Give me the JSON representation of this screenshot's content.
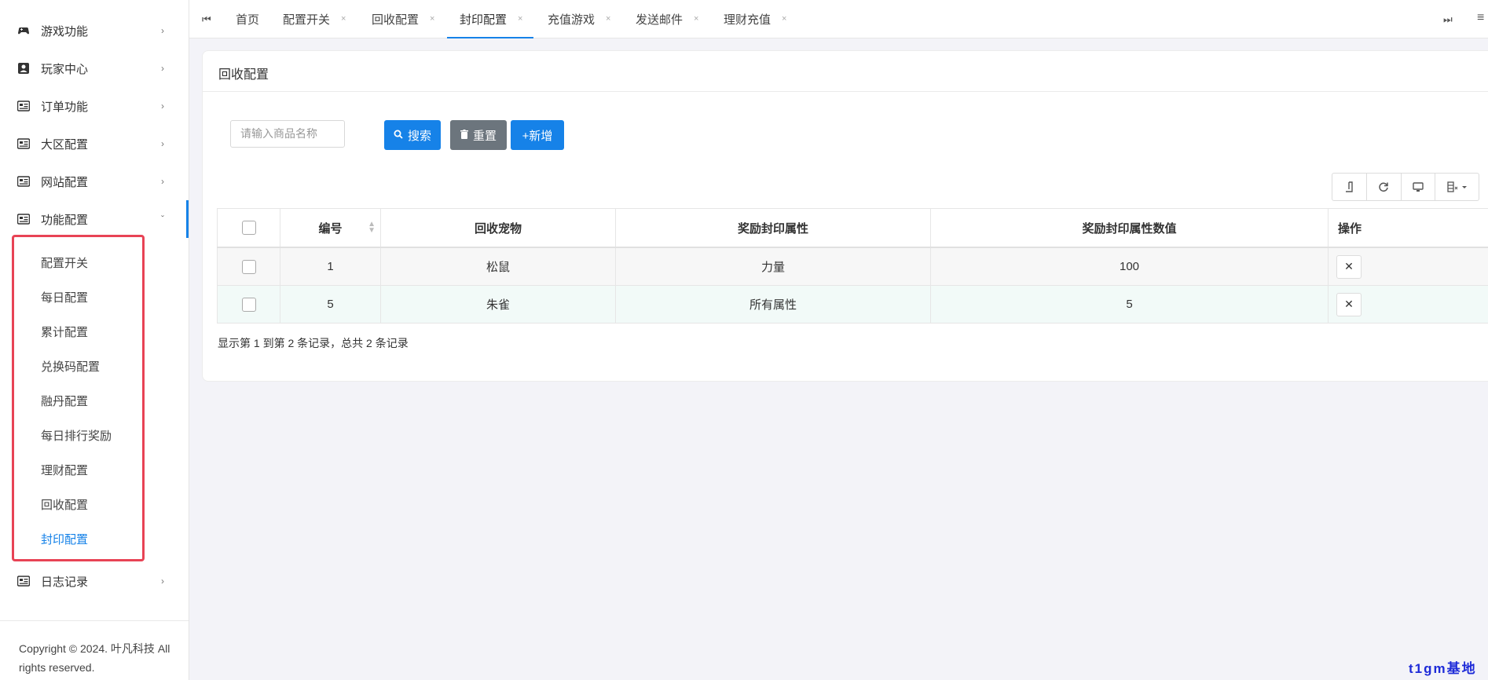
{
  "sidebar": {
    "items": [
      {
        "label": "游戏功能",
        "icon": "gamepad-icon",
        "chev": "›"
      },
      {
        "label": "玩家中心",
        "icon": "user-card-icon",
        "chev": "›"
      },
      {
        "label": "订单功能",
        "icon": "list-card-icon",
        "chev": "›"
      },
      {
        "label": "大区配置",
        "icon": "list-card-icon",
        "chev": "›"
      },
      {
        "label": "网站配置",
        "icon": "list-card-icon",
        "chev": "›"
      },
      {
        "label": "功能配置",
        "icon": "list-card-icon",
        "chev": "ˇ"
      }
    ],
    "submenu": [
      "配置开关",
      "每日配置",
      "累计配置",
      "兑换码配置",
      "融丹配置",
      "每日排行奖励",
      "理财配置",
      "回收配置",
      "封印配置"
    ],
    "last_item": {
      "label": "日志记录",
      "icon": "list-card-icon",
      "chev": "›"
    },
    "copyright": "Copyright © 2024. 叶凡科技 All rights reserved."
  },
  "tabbar": {
    "first_nav": "⏮",
    "last_nav": "⏭",
    "menu": "≡",
    "tabs": [
      {
        "label": "首页",
        "closable": false
      },
      {
        "label": "配置开关",
        "closable": true
      },
      {
        "label": "回收配置",
        "closable": true
      },
      {
        "label": "封印配置",
        "closable": true
      },
      {
        "label": "充值游戏",
        "closable": true
      },
      {
        "label": "发送邮件",
        "closable": true
      },
      {
        "label": "理财充值",
        "closable": true
      }
    ],
    "close_glyph": "×"
  },
  "card": {
    "title": "回收配置",
    "search_placeholder": "请输入商品名称",
    "buttons": {
      "search": "搜索",
      "reset": "重置",
      "add": "+新增"
    }
  },
  "table": {
    "headers": [
      "编号",
      "回收宠物",
      "奖励封印属性",
      "奖励封印属性数值",
      "操作"
    ],
    "rows": [
      {
        "id": "1",
        "pet": "松鼠",
        "attr": "力量",
        "value": "100"
      },
      {
        "id": "5",
        "pet": "朱雀",
        "attr": "所有属性",
        "value": "5"
      }
    ],
    "delete_glyph": "✕"
  },
  "pagination": {
    "info": "显示第 1 到第 2 条记录，总共 2 条记录"
  },
  "watermark": "t1gm基地",
  "colors": {
    "accent": "#1682e8",
    "reset": "#6c757d",
    "highlight": "#e84355"
  }
}
